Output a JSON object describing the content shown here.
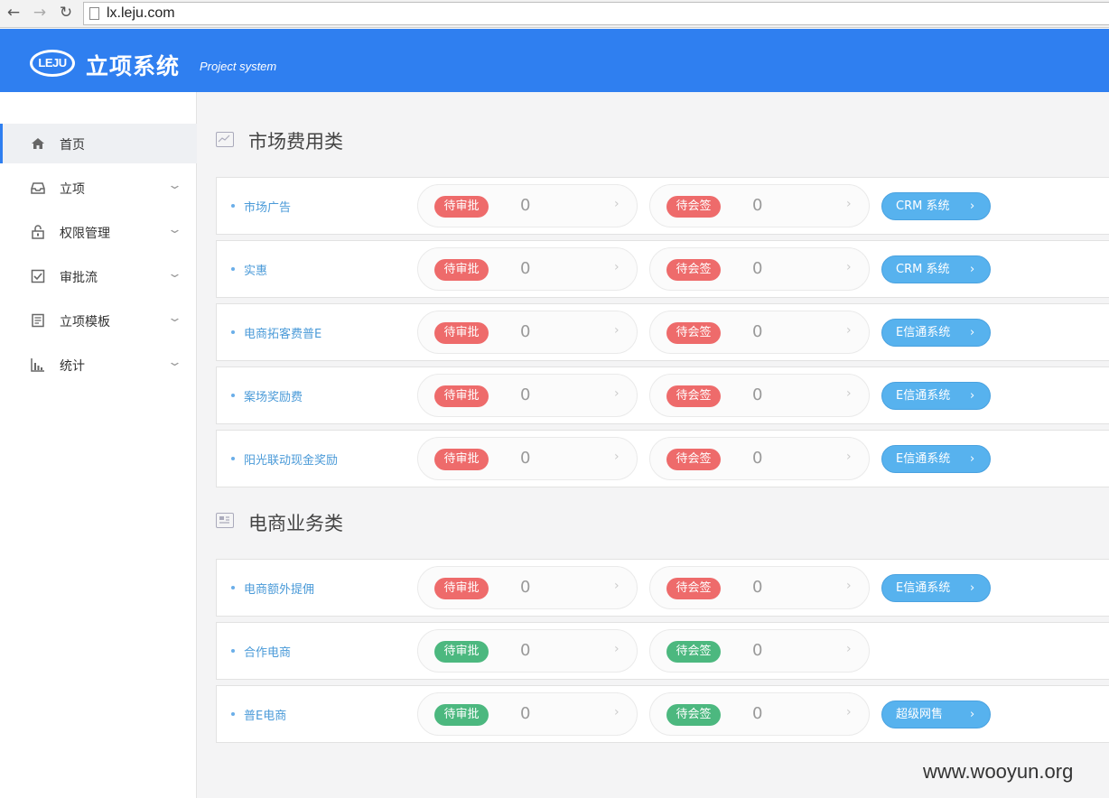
{
  "browser": {
    "url": "lx.leju.com"
  },
  "header": {
    "logo_text": "LEJU",
    "title": "立项系统",
    "subtitle": "Project system"
  },
  "sidebar": {
    "items": [
      {
        "label": "首页",
        "icon": "home-icon",
        "active": true
      },
      {
        "label": "立项",
        "icon": "inbox-icon",
        "active": false
      },
      {
        "label": "权限管理",
        "icon": "lock-icon",
        "active": false
      },
      {
        "label": "审批流",
        "icon": "checkbox-icon",
        "active": false
      },
      {
        "label": "立项模板",
        "icon": "document-icon",
        "active": false
      },
      {
        "label": "统计",
        "icon": "bar-chart-icon",
        "active": false
      }
    ]
  },
  "sections": [
    {
      "title": "市场费用类",
      "rows": [
        {
          "name": "市场广告",
          "approve_label": "待审批",
          "approve_count": "0",
          "sign_label": "待会签",
          "sign_count": "0",
          "system": "CRM 系统",
          "status_color": "#ee6b6b"
        },
        {
          "name": "实惠",
          "approve_label": "待审批",
          "approve_count": "0",
          "sign_label": "待会签",
          "sign_count": "0",
          "system": "CRM 系统",
          "status_color": "#ee6b6b"
        },
        {
          "name": "电商拓客费普E",
          "approve_label": "待审批",
          "approve_count": "0",
          "sign_label": "待会签",
          "sign_count": "0",
          "system": "E信通系统",
          "status_color": "#ee6b6b"
        },
        {
          "name": "案场奖励费",
          "approve_label": "待审批",
          "approve_count": "0",
          "sign_label": "待会签",
          "sign_count": "0",
          "system": "E信通系统",
          "status_color": "#ee6b6b"
        },
        {
          "name": "阳光联动现金奖励",
          "approve_label": "待审批",
          "approve_count": "0",
          "sign_label": "待会签",
          "sign_count": "0",
          "system": "E信通系统",
          "status_color": "#ee6b6b"
        }
      ]
    },
    {
      "title": "电商业务类",
      "rows": [
        {
          "name": "电商额外提佣",
          "approve_label": "待审批",
          "approve_count": "0",
          "sign_label": "待会签",
          "sign_count": "0",
          "system": "E信通系统",
          "status_color": "#ee6b6b"
        },
        {
          "name": "合作电商",
          "approve_label": "待审批",
          "approve_count": "0",
          "sign_label": "待会签",
          "sign_count": "0",
          "system": "",
          "status_color": "#4cb87f"
        },
        {
          "name": "普E电商",
          "approve_label": "待审批",
          "approve_count": "0",
          "sign_label": "待会签",
          "sign_count": "0",
          "system": "超级网售",
          "status_color": "#4cb87f"
        }
      ]
    }
  ],
  "watermark": "www.wooyun.org",
  "colors": {
    "header": "#2f7ff0",
    "red_badge": "#ee6b6b",
    "green_badge": "#4cb87f",
    "system_button": "#57b2ee"
  }
}
